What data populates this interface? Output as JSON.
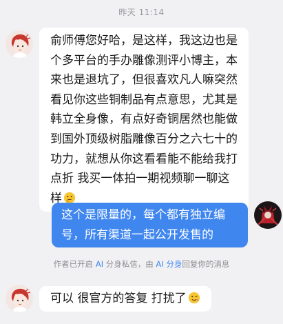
{
  "timestamp": "昨天 11:14",
  "messages": [
    {
      "direction": "in",
      "text": "俞师傅您好哈，是这样，我这边也是个多平台的手办雕像测评小博主，本来也是退坑了，但很喜欢凡人嘛突然看见你这些铜制品有点意思，尤其是韩立全身像，有点好奇铜居然也能做到国外顶级树脂雕像百分之六七十的功力，就想从你这看看能不能给我打点折 我买一体拍一期视频聊一聊这样",
      "emoji": "thinking-face-emoji"
    },
    {
      "direction": "out",
      "text": "这个是限量的，每个都有独立编号，所有渠道一起公开发售的"
    },
    {
      "direction": "in",
      "text": "可以 很官方的答复 打扰了",
      "emoji": "winking-face-emoji"
    }
  ],
  "notice": {
    "prefix": "作者已开启 ",
    "ai1": "AI",
    "middle": " 分身私信，由 ",
    "ai2": "AI 分身",
    "suffix": "回复你的消息"
  },
  "colors": {
    "background": "#f1f1f3",
    "outgoing_bubble": "#3f86ef",
    "incoming_bubble": "#ffffff",
    "link": "#3f86ef"
  }
}
